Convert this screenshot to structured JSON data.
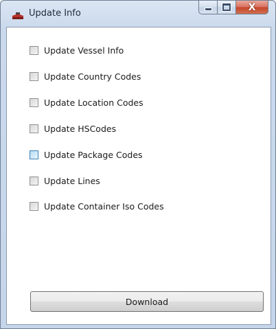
{
  "window": {
    "title": "Update Info",
    "icon": "window-app-icon"
  },
  "caption": {
    "minimize_icon": "minimize-icon",
    "maximize_icon": "maximize-icon",
    "close_glyph": "X"
  },
  "options": [
    {
      "label": "Update Vessel Info",
      "checked": false
    },
    {
      "label": "Update Country Codes",
      "checked": false
    },
    {
      "label": "Update Location Codes",
      "checked": false
    },
    {
      "label": "Update HSCodes",
      "checked": false
    },
    {
      "label": "Update Package Codes",
      "checked": false,
      "hovered": true
    },
    {
      "label": "Update Lines",
      "checked": false
    },
    {
      "label": "Update Container Iso Codes",
      "checked": false
    }
  ],
  "actions": {
    "download_label": "Download"
  }
}
